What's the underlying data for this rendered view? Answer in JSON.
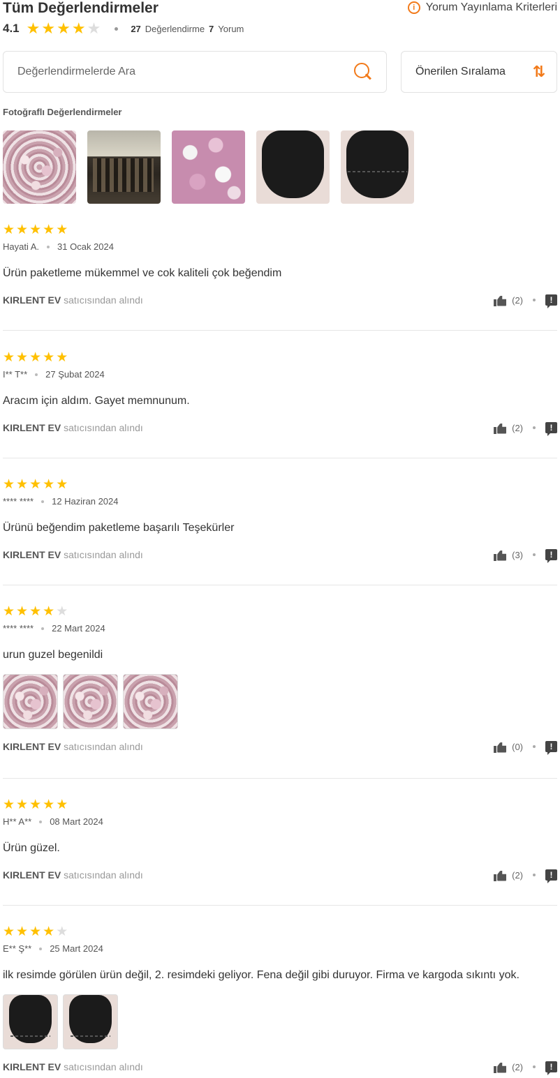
{
  "header": {
    "title": "Tüm Değerlendirmeler",
    "criteria_link": "Yorum Yayınlama Kriterleri",
    "info_icon": "i",
    "average": "4.1",
    "average_stars": 4,
    "rating_count": "27",
    "rating_label": "Değerlendirme",
    "comment_count": "7",
    "comment_label": "Yorum"
  },
  "search": {
    "placeholder": "Değerlendirmelerde Ara",
    "value": ""
  },
  "sort": {
    "label": "Önerilen Sıralama",
    "icon": "⇅"
  },
  "photo_section": {
    "title": "Fotoğraflı Değerlendirmeler",
    "thumbnails": [
      "flowers",
      "colosseum",
      "peonies",
      "cushion",
      "cushion"
    ]
  },
  "colors": {
    "accent": "#f27a1a",
    "star": "#ffc000",
    "star_off": "#dddddd"
  },
  "reviews": [
    {
      "stars": 5,
      "author": "Hayati A.",
      "date": "31 Ocak 2024",
      "text": "Ürün paketleme mükemmel ve cok kaliteli çok beğendim",
      "seller": "KIRLENT EV",
      "seller_suffix": "satıcısından alındı",
      "likes": "(2)",
      "report_icon": "!"
    },
    {
      "stars": 5,
      "author": "I** T**",
      "date": "27 Şubat 2024",
      "text": "Aracım için aldım. Gayet memnunum.",
      "seller": "KIRLENT EV",
      "seller_suffix": "satıcısından alındı",
      "likes": "(2)",
      "report_icon": "!"
    },
    {
      "stars": 5,
      "author": "**** ****",
      "date": "12 Haziran 2024",
      "text": "Ürünü beğendim paketleme başarılı Teşekürler",
      "seller": "KIRLENT EV",
      "seller_suffix": "satıcısından alındı",
      "likes": "(3)",
      "report_icon": "!"
    },
    {
      "stars": 4,
      "author": "**** ****",
      "date": "22 Mart 2024",
      "text": "urun guzel begenildi",
      "seller": "KIRLENT EV",
      "seller_suffix": "satıcısından alındı",
      "likes": "(0)",
      "report_icon": "!"
    },
    {
      "stars": 5,
      "author": "H** A**",
      "date": "08 Mart 2024",
      "text": "Ürün güzel.",
      "seller": "KIRLENT EV",
      "seller_suffix": "satıcısından alındı",
      "likes": "(2)",
      "report_icon": "!"
    },
    {
      "stars": 4,
      "author": "E** Ş**",
      "date": "25 Mart 2024",
      "text": "ilk resimde görülen ürün değil, 2. resimdeki geliyor. Fena değil gibi duruyor. Firma ve kargoda sıkıntı yok.",
      "seller": "KIRLENT EV",
      "seller_suffix": "satıcısından alındı",
      "likes": "(2)",
      "report_icon": "!"
    }
  ]
}
